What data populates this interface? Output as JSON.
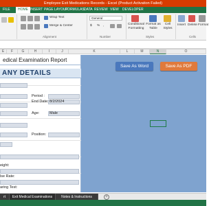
{
  "window": {
    "title": "Employee Exit Medications Records - Excel (Product Activation Failed)"
  },
  "ribbon_tabs": [
    "FILE",
    "HOME",
    "INSERT",
    "PAGE LAYOUT",
    "FORMULAS",
    "DATA",
    "REVIEW",
    "VIEW",
    "DEVELOPER"
  ],
  "ribbon": {
    "alignment": {
      "wrap_text": "Wrap Text",
      "merge_center": "Merge & Center",
      "group_label": "Alignment"
    },
    "number": {
      "format_value": "General",
      "currency_symbol": "$",
      "percent_symbol": "%",
      "comma_symbol": ",",
      "group_label": "Number"
    },
    "styles": {
      "conditional_formatting": "Conditional Formatting",
      "format_as_table": "Format as Table",
      "cell_styles": "Cell Styles",
      "group_label": "Styles"
    },
    "cells": {
      "insert": "Insert",
      "delete": "Delete",
      "format": "Format",
      "group_label": "Cells"
    }
  },
  "columns": [
    "E",
    "F",
    "G",
    "H",
    "I",
    "J",
    "K",
    "L",
    "M",
    "N",
    "O"
  ],
  "selected_column": "N",
  "sheet": {
    "report_title": "edical Examination Report",
    "company_heading": "ANY DETAILS",
    "fields": {
      "period_label": "Period :",
      "end_date_label": "End Date:",
      "end_date_value": "8/2/2024",
      "age_label": "Age:",
      "age_value": "Male",
      "position_label": "Position:",
      "height_label": "eight:",
      "pulse_label": "lse Rate:",
      "hearing_label": "aring Test:"
    }
  },
  "buttons": {
    "save_word": "Save As Word",
    "save_pdf": "Save As PDF"
  },
  "sheet_tabs": [
    "rt",
    "Exit Medical Examinations",
    "Notes & Instructions"
  ],
  "colors": {
    "excel_green": "#217346",
    "title_bar": "#d83b01",
    "panel_blue": "#7fa3cf",
    "word_button": "#4a78bd",
    "pdf_button": "#e07a3c"
  }
}
